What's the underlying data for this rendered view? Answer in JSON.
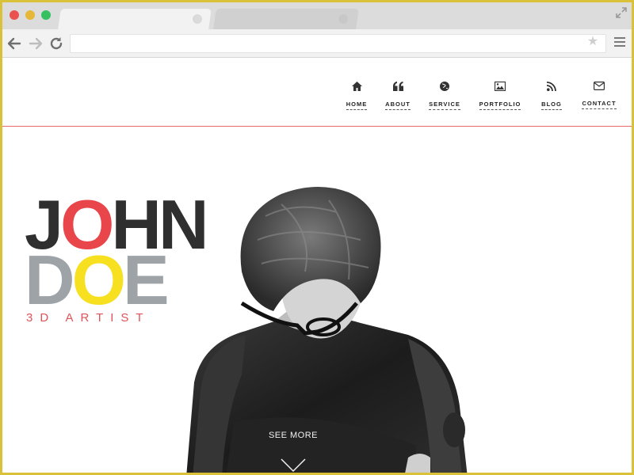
{
  "colors": {
    "frame_border": "#d9c23a",
    "accent_red": "#e8464b",
    "accent_yellow": "#f6e020",
    "dark_text": "#2f2f2f",
    "grey_text": "#9ea3a8",
    "divider": "#e86a6a"
  },
  "browser": {
    "traffic_lights": [
      "close",
      "minimize",
      "maximize"
    ],
    "address_value": "",
    "icons": [
      "back-arrow-icon",
      "forward-arrow-icon",
      "reload-icon",
      "star-icon",
      "hamburger-menu-icon",
      "fullscreen-icon"
    ]
  },
  "nav": {
    "items": [
      {
        "label": "HOME",
        "icon": "home-icon"
      },
      {
        "label": "ABOUT",
        "icon": "quote-icon"
      },
      {
        "label": "SERVICE",
        "icon": "globe-icon"
      },
      {
        "label": "PORTFOLIO",
        "icon": "image-icon"
      },
      {
        "label": "BLOG",
        "icon": "rss-icon"
      },
      {
        "label": "CONTACT",
        "icon": "envelope-icon"
      }
    ]
  },
  "hero": {
    "name_line1_prefix": "J",
    "name_line1_o": "O",
    "name_line1_suffix": "HN",
    "name_line2_prefix": "D",
    "name_line2_o": "O",
    "name_line2_suffix": "E",
    "subtitle": "3D ARTIST",
    "see_more": "SEE MORE"
  }
}
